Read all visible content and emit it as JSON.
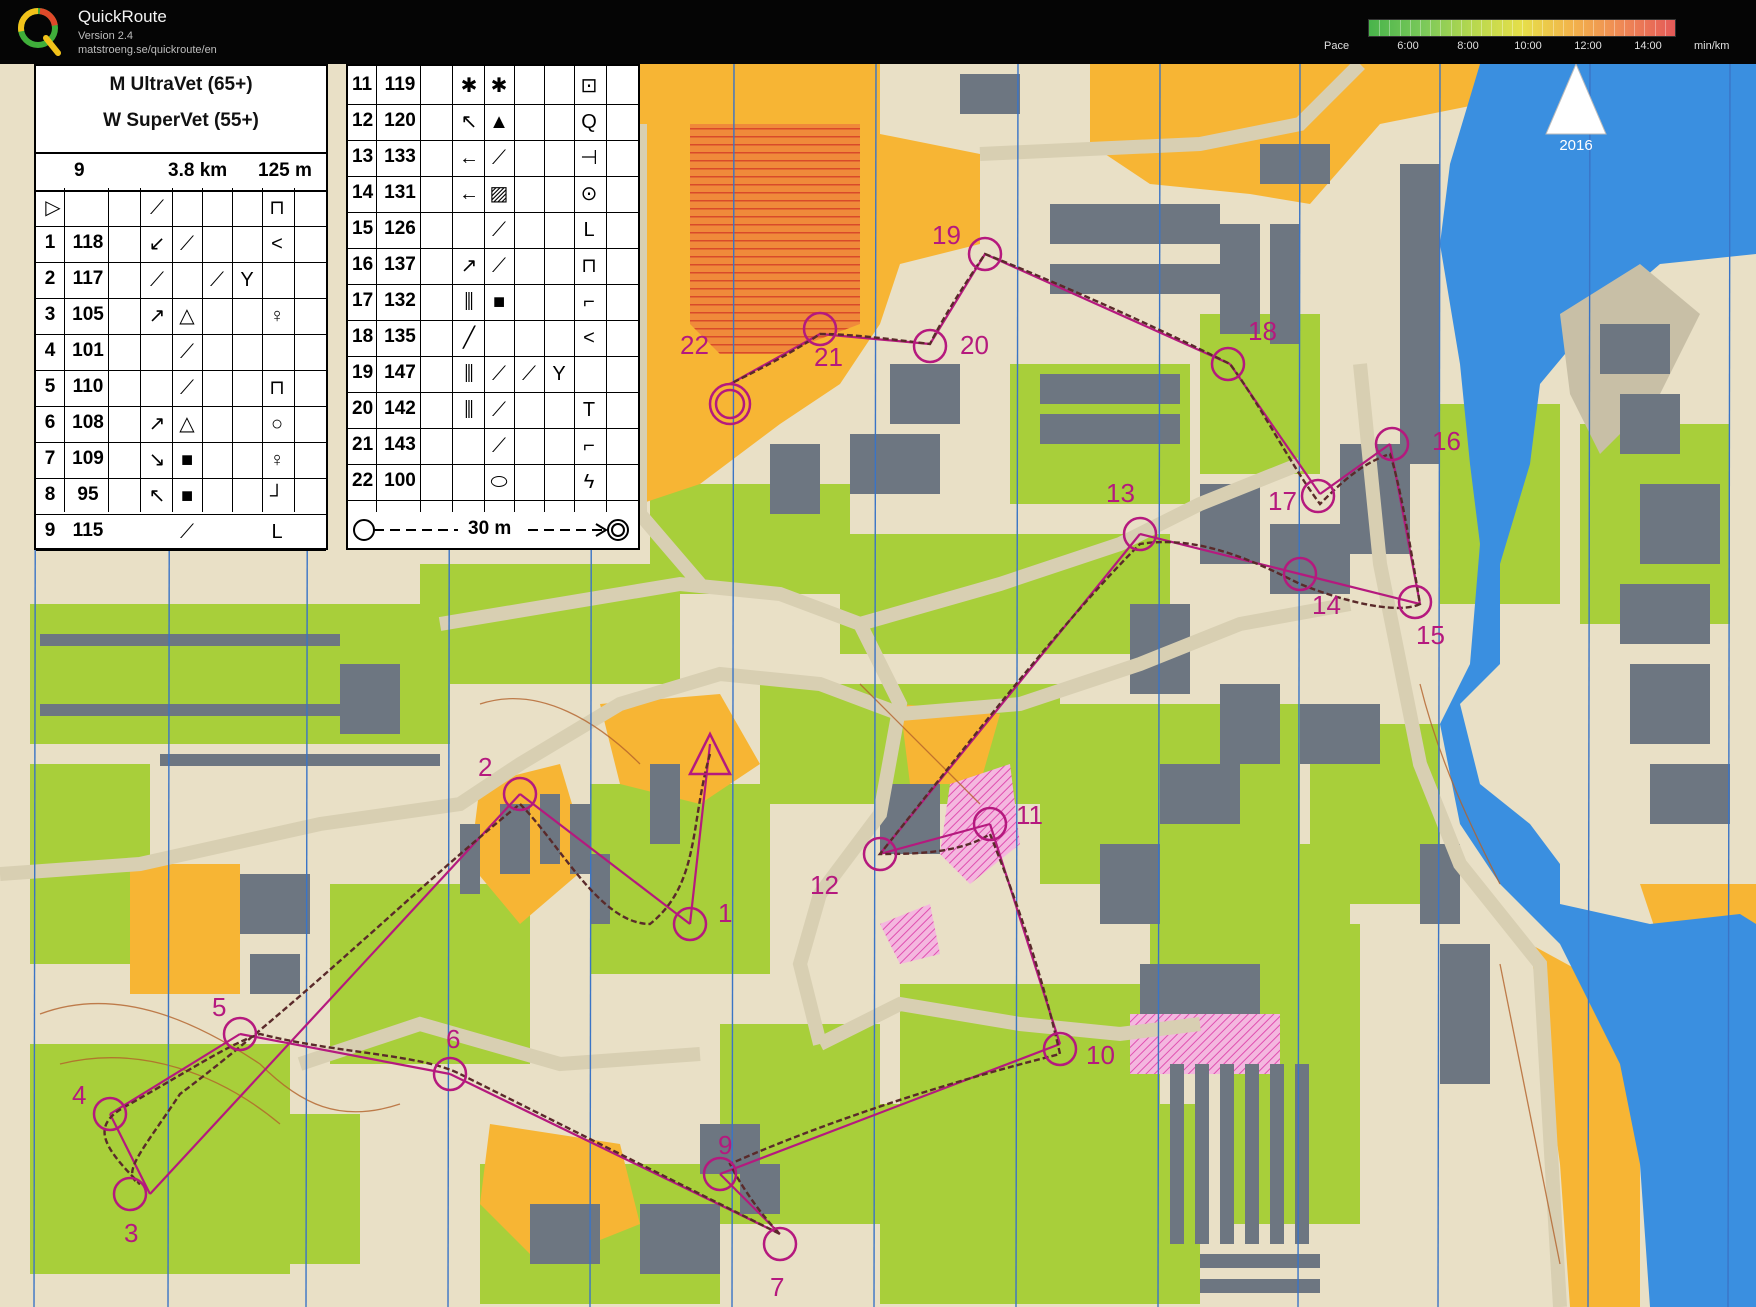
{
  "header": {
    "app_title": "QuickRoute",
    "version": "Version 2.4",
    "url": "matstroeng.se/quickroute/en",
    "pace_label": "Pace",
    "pace_unit": "min/km",
    "pace_ticks": [
      "6:00",
      "8:00",
      "10:00",
      "12:00",
      "14:00"
    ],
    "pace_colors": [
      "#49b44b",
      "#b7d84f",
      "#e6df4a",
      "#f2b44b",
      "#e45a58"
    ]
  },
  "map": {
    "north_arrow_year": "2016",
    "controls": [
      "1",
      "2",
      "3",
      "4",
      "5",
      "6",
      "7",
      "9",
      "10",
      "11",
      "12",
      "13",
      "14",
      "15",
      "16",
      "17",
      "18",
      "19",
      "20",
      "21",
      "22"
    ],
    "colors": {
      "green": "#a8cf3a",
      "yellow": "#f7b534",
      "paved": "#e8dfc4",
      "building": "#6d7681",
      "water": "#3a8fe0",
      "course": "#b5197e",
      "route": "#5a2a2a"
    }
  },
  "description_sheet": {
    "class_lines": [
      "M UltraVet (65+)",
      "W SuperVet (55+)"
    ],
    "controls_count": "9",
    "length": "3.8 km",
    "climb": "125 m",
    "left_rows": [
      {
        "n": "1",
        "code": "118"
      },
      {
        "n": "2",
        "code": "117"
      },
      {
        "n": "3",
        "code": "105"
      },
      {
        "n": "4",
        "code": "101"
      },
      {
        "n": "5",
        "code": "110"
      },
      {
        "n": "6",
        "code": "108"
      },
      {
        "n": "7",
        "code": "109"
      },
      {
        "n": "8",
        "code": "95"
      },
      {
        "n": "9",
        "code": "115"
      }
    ],
    "right_rows": [
      {
        "n": "11",
        "code": "119"
      },
      {
        "n": "12",
        "code": "120"
      },
      {
        "n": "13",
        "code": "133"
      },
      {
        "n": "14",
        "code": "131"
      },
      {
        "n": "15",
        "code": "126"
      },
      {
        "n": "16",
        "code": "137"
      },
      {
        "n": "17",
        "code": "132"
      },
      {
        "n": "18",
        "code": "135"
      },
      {
        "n": "19",
        "code": "147"
      },
      {
        "n": "20",
        "code": "142"
      },
      {
        "n": "21",
        "code": "143"
      },
      {
        "n": "22",
        "code": "100"
      }
    ],
    "finish_distance": "30 m"
  }
}
